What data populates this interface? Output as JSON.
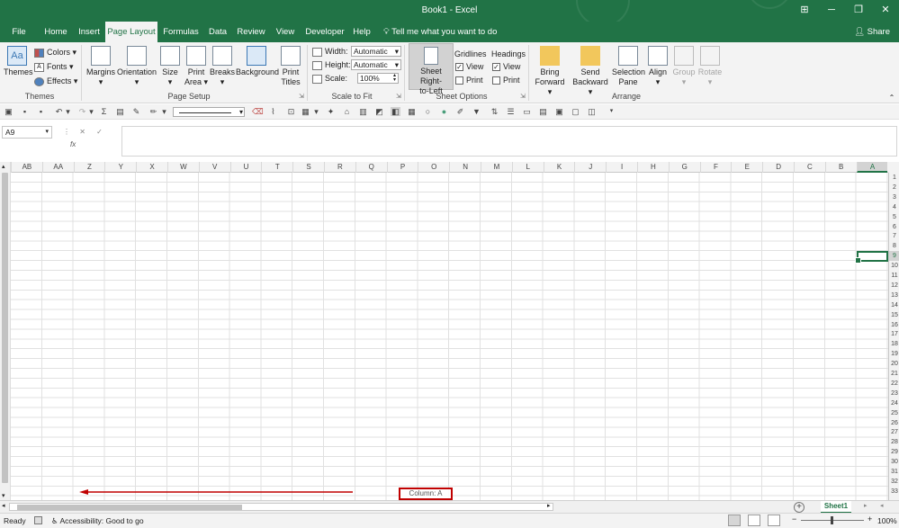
{
  "title": "Book1  -  Excel",
  "window_buttons": [
    "⊞",
    "─",
    "❐",
    "✕"
  ],
  "tabs": [
    {
      "label": "File",
      "active": false
    },
    {
      "label": "Home",
      "active": false
    },
    {
      "label": "Insert",
      "active": false
    },
    {
      "label": "Page Layout",
      "active": true
    },
    {
      "label": "Formulas",
      "active": false
    },
    {
      "label": "Data",
      "active": false
    },
    {
      "label": "Review",
      "active": false
    },
    {
      "label": "View",
      "active": false
    },
    {
      "label": "Developer",
      "active": false
    },
    {
      "label": "Help",
      "active": false
    }
  ],
  "tell_me": "Tell me what you want to do",
  "share": "Share",
  "ribbon": {
    "themes": {
      "themes": "Themes",
      "colors": "Colors",
      "fonts": "Fonts",
      "effects": "Effects",
      "group": "Themes"
    },
    "page_setup": {
      "margins": "Margins",
      "orientation": "Orientation",
      "size": "Size",
      "print_area": "Print Area",
      "breaks": "Breaks",
      "background": "Background",
      "print_titles": "Print Titles",
      "group": "Page Setup"
    },
    "scale": {
      "width_label": "Width:",
      "width_value": "Automatic",
      "height_label": "Height:",
      "height_value": "Automatic",
      "scale_label": "Scale:",
      "scale_value": "100%",
      "group": "Scale to Fit"
    },
    "sheet_options": {
      "rtl_line1": "Sheet Right-",
      "rtl_line2": "to-Left",
      "gridlines": "Gridlines",
      "headings": "Headings",
      "view": "View",
      "print": "Print",
      "group": "Sheet Options"
    },
    "arrange": {
      "bring_forward": "Bring Forward",
      "send_backward": "Send Backward",
      "selection_pane": "Selection Pane",
      "align": "Align",
      "group_btn": "Group",
      "rotate": "Rotate",
      "group": "Arrange"
    }
  },
  "formula_bar": {
    "name_box": "A9",
    "fx": "fx"
  },
  "columns": [
    "AB",
    "AA",
    "Z",
    "Y",
    "X",
    "W",
    "V",
    "U",
    "T",
    "S",
    "R",
    "Q",
    "P",
    "O",
    "N",
    "M",
    "L",
    "K",
    "J",
    "I",
    "H",
    "G",
    "F",
    "E",
    "D",
    "C",
    "B",
    "A"
  ],
  "selected_column": "A",
  "rows": [
    "1",
    "2",
    "3",
    "4",
    "5",
    "6",
    "7",
    "8",
    "9",
    "10",
    "11",
    "12",
    "13",
    "14",
    "15",
    "16",
    "17",
    "18",
    "19",
    "20",
    "21",
    "22",
    "23",
    "24",
    "25",
    "26",
    "27",
    "28",
    "29",
    "30",
    "31",
    "32",
    "33"
  ],
  "selected_row": "9",
  "callout": "Column: A",
  "sheet_tab": "Sheet1",
  "status": {
    "ready": "Ready",
    "accessibility": "Accessibility: Good to go",
    "zoom": "100%"
  },
  "colors": {
    "accent": "#217346",
    "annotation": "#c00000"
  }
}
